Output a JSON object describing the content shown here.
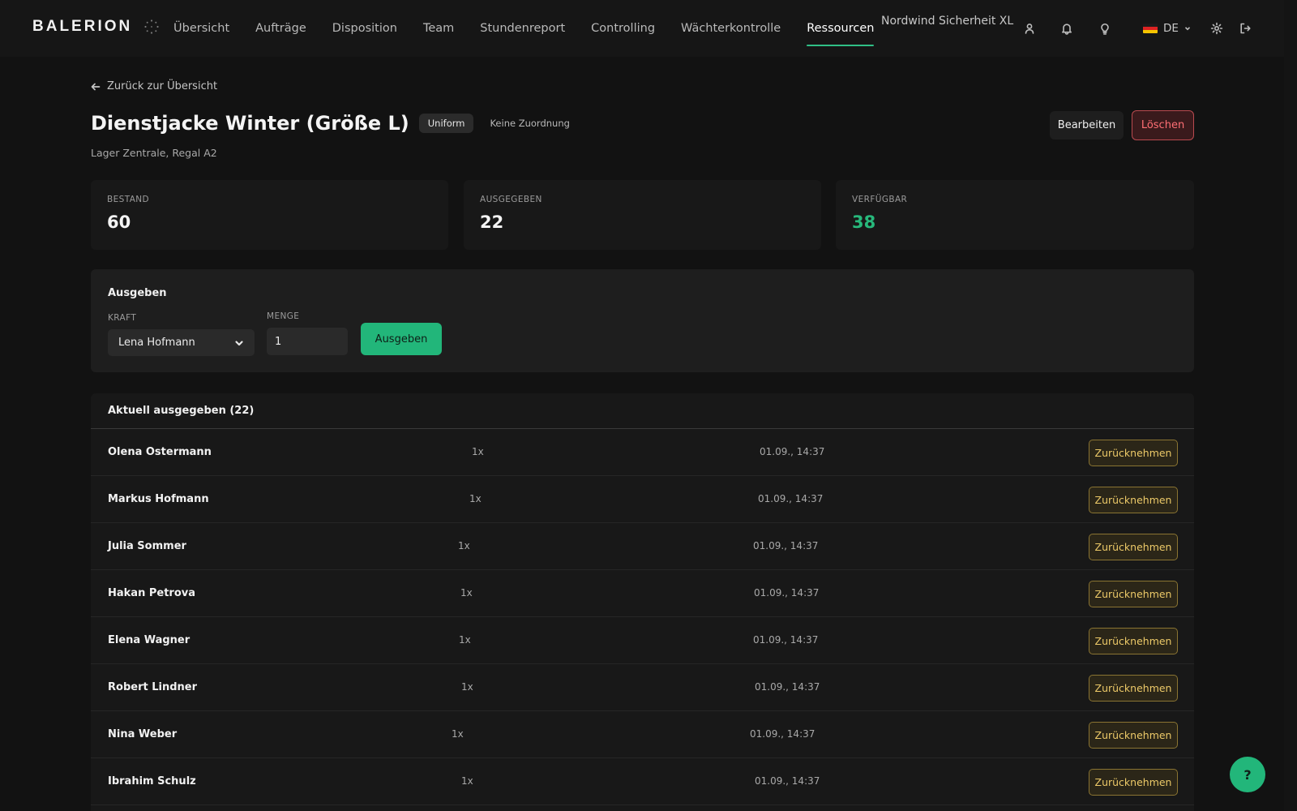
{
  "brand": {
    "name": "BALERION",
    "mark_icon": "sun-spark-icon"
  },
  "nav": [
    {
      "label": "Übersicht",
      "active": false
    },
    {
      "label": "Aufträge",
      "active": false
    },
    {
      "label": "Disposition",
      "active": false
    },
    {
      "label": "Team",
      "active": false
    },
    {
      "label": "Stundenreport",
      "active": false
    },
    {
      "label": "Controlling",
      "active": false
    },
    {
      "label": "Wächterkontrolle",
      "active": false
    },
    {
      "label": "Ressourcen",
      "active": true
    }
  ],
  "header": {
    "tenant": "Nordwind Sicherheit XL",
    "language": "DE",
    "icons": [
      "user-icon",
      "bell-icon",
      "lightbulb-icon",
      "germany-flag-icon",
      "gear-icon",
      "logout-icon"
    ]
  },
  "page": {
    "back_label": "Zurück zur Übersicht",
    "title": "Dienstjacke Winter (Größe L)",
    "category_tag": "Uniform",
    "assignment_tag": "Keine Zuordnung",
    "location": "Lager Zentrale, Regal A2",
    "edit_label": "Bearbeiten",
    "delete_label": "Löschen"
  },
  "stats": [
    {
      "label": "BESTAND",
      "value": "60"
    },
    {
      "label": "AUSGEGEBEN",
      "value": "22"
    },
    {
      "label": "VERFÜGBAR",
      "value": "38"
    }
  ],
  "issue_form": {
    "title": "Ausgeben",
    "person_label": "KRAFT",
    "person_value": "Lena Hofmann",
    "quantity_label": "MENGE",
    "quantity_value": "1",
    "submit_label": "Ausgeben"
  },
  "issued": {
    "heading": "Aktuell ausgegeben (22)",
    "return_label": "Zurücknehmen",
    "rows": [
      {
        "name": "Olena Ostermann",
        "qty": "1x",
        "date": "01.09., 14:37"
      },
      {
        "name": "Markus Hofmann",
        "qty": "1x",
        "date": "01.09., 14:37"
      },
      {
        "name": "Julia Sommer",
        "qty": "1x",
        "date": "01.09., 14:37"
      },
      {
        "name": "Hakan Petrova",
        "qty": "1x",
        "date": "01.09., 14:37"
      },
      {
        "name": "Elena Wagner",
        "qty": "1x",
        "date": "01.09., 14:37"
      },
      {
        "name": "Robert Lindner",
        "qty": "1x",
        "date": "01.09., 14:37"
      },
      {
        "name": "Nina Weber",
        "qty": "1x",
        "date": "01.09., 14:37"
      },
      {
        "name": "Ibrahim Schulz",
        "qty": "1x",
        "date": "01.09., 14:37"
      }
    ]
  },
  "help": {
    "label": "?"
  },
  "colors": {
    "background": "#121212",
    "accent_green": "#22b67a",
    "danger": "#ff6f74",
    "return_gold": "#ecc968"
  }
}
